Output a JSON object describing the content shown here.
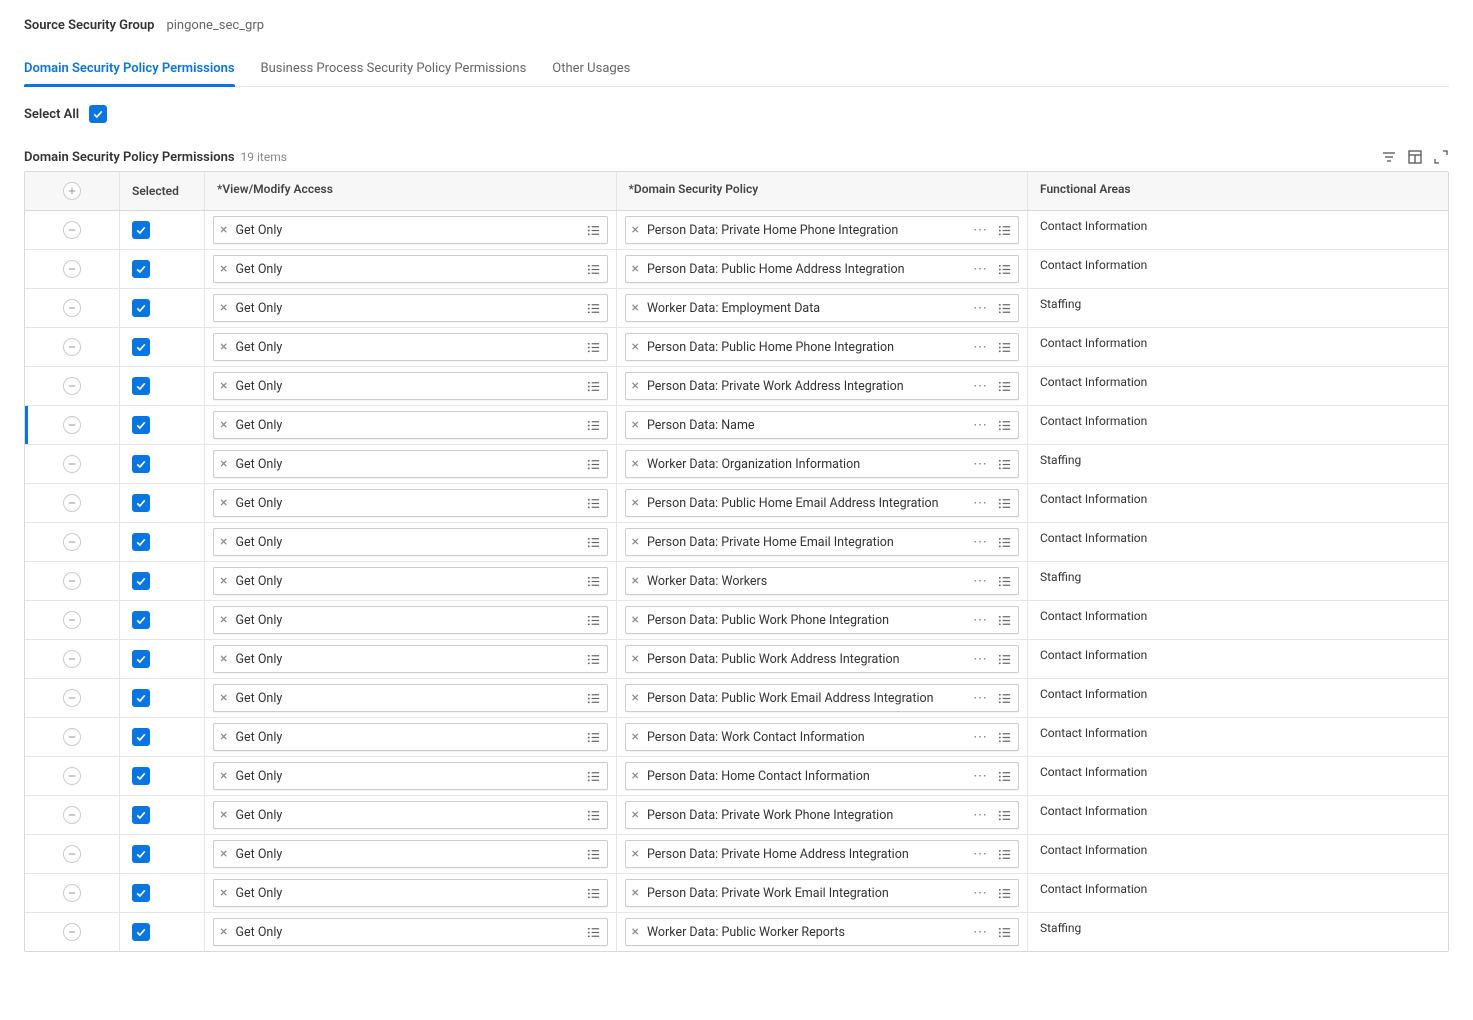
{
  "header": {
    "label": "Source Security Group",
    "value": "pingone_sec_grp"
  },
  "tabs": [
    {
      "label": "Domain Security Policy Permissions",
      "active": true
    },
    {
      "label": "Business Process Security Policy Permissions",
      "active": false
    },
    {
      "label": "Other Usages",
      "active": false
    }
  ],
  "select_all_label": "Select All",
  "table": {
    "title": "Domain Security Policy Permissions",
    "count_label": "19 items",
    "columns": {
      "selected": "Selected",
      "access": "*View/Modify Access",
      "policy": "*Domain Security Policy",
      "functional": "Functional Areas"
    },
    "rows": [
      {
        "selected": true,
        "access": "Get Only",
        "policy": "Person Data: Private Home Phone Integration",
        "functional": "Contact Information",
        "highlight": false
      },
      {
        "selected": true,
        "access": "Get Only",
        "policy": "Person Data: Public Home Address Integration",
        "functional": "Contact Information",
        "highlight": false
      },
      {
        "selected": true,
        "access": "Get Only",
        "policy": "Worker Data: Employment Data",
        "functional": "Staffing",
        "highlight": false
      },
      {
        "selected": true,
        "access": "Get Only",
        "policy": "Person Data: Public Home Phone Integration",
        "functional": "Contact Information",
        "highlight": false
      },
      {
        "selected": true,
        "access": "Get Only",
        "policy": "Person Data: Private Work Address Integration",
        "functional": "Contact Information",
        "highlight": false
      },
      {
        "selected": true,
        "access": "Get Only",
        "policy": "Person Data: Name",
        "functional": "Contact Information",
        "highlight": true
      },
      {
        "selected": true,
        "access": "Get Only",
        "policy": "Worker Data: Organization Information",
        "functional": "Staffing",
        "highlight": false
      },
      {
        "selected": true,
        "access": "Get Only",
        "policy": "Person Data: Public Home Email Address Integration",
        "functional": "Contact Information",
        "highlight": false
      },
      {
        "selected": true,
        "access": "Get Only",
        "policy": "Person Data: Private Home Email Integration",
        "functional": "Contact Information",
        "highlight": false
      },
      {
        "selected": true,
        "access": "Get Only",
        "policy": "Worker Data: Workers",
        "functional": "Staffing",
        "highlight": false
      },
      {
        "selected": true,
        "access": "Get Only",
        "policy": "Person Data: Public Work Phone Integration",
        "functional": "Contact Information",
        "highlight": false
      },
      {
        "selected": true,
        "access": "Get Only",
        "policy": "Person Data: Public Work Address Integration",
        "functional": "Contact Information",
        "highlight": false
      },
      {
        "selected": true,
        "access": "Get Only",
        "policy": "Person Data: Public Work Email Address Integration",
        "functional": "Contact Information",
        "highlight": false
      },
      {
        "selected": true,
        "access": "Get Only",
        "policy": "Person Data: Work Contact Information",
        "functional": "Contact Information",
        "highlight": false
      },
      {
        "selected": true,
        "access": "Get Only",
        "policy": "Person Data: Home Contact Information",
        "functional": "Contact Information",
        "highlight": false
      },
      {
        "selected": true,
        "access": "Get Only",
        "policy": "Person Data: Private Work Phone Integration",
        "functional": "Contact Information",
        "highlight": false
      },
      {
        "selected": true,
        "access": "Get Only",
        "policy": "Person Data: Private Home Address Integration",
        "functional": "Contact Information",
        "highlight": false
      },
      {
        "selected": true,
        "access": "Get Only",
        "policy": "Person Data: Private Work Email Integration",
        "functional": "Contact Information",
        "highlight": false
      },
      {
        "selected": true,
        "access": "Get Only",
        "policy": "Worker Data: Public Worker Reports",
        "functional": "Staffing",
        "highlight": false
      }
    ]
  }
}
